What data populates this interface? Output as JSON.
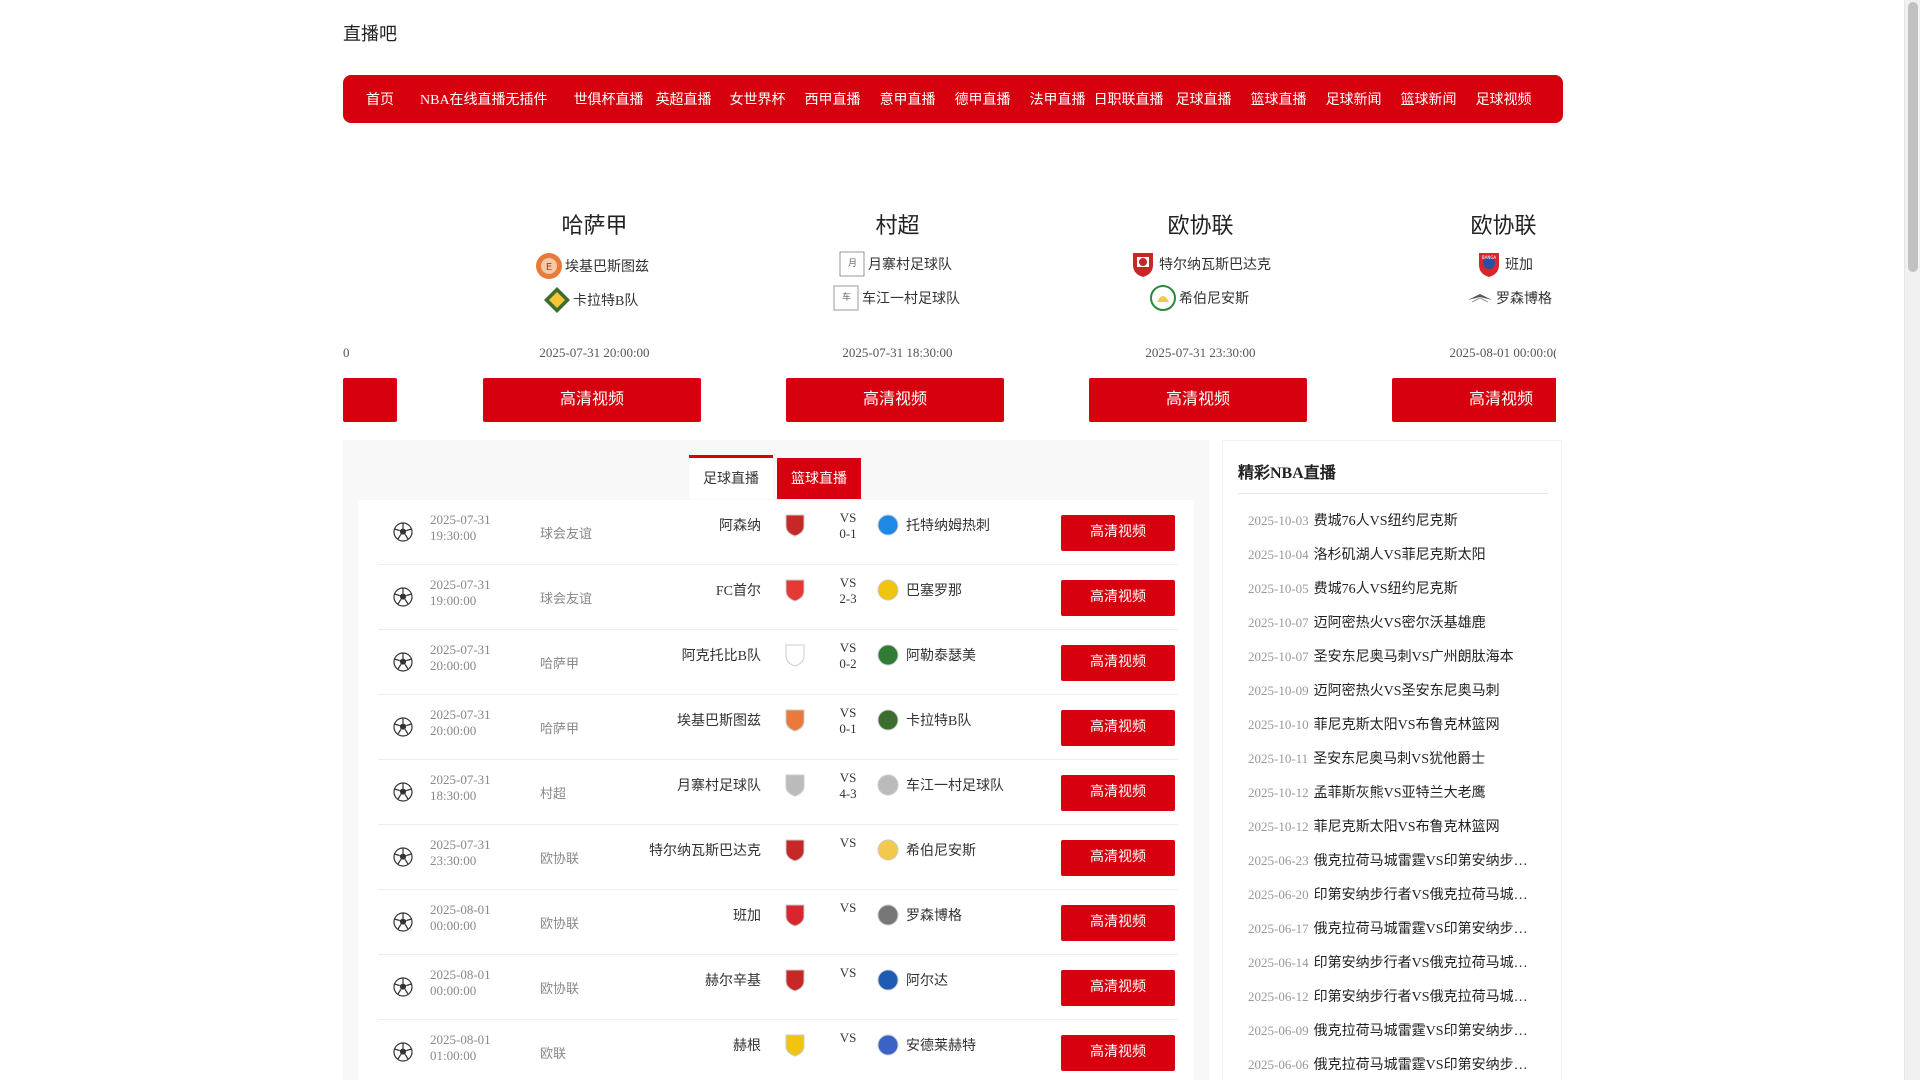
{
  "site": {
    "title": "直播吧"
  },
  "nav": [
    "首页",
    "NBA在线直播无插件",
    "世俱杯直播",
    "英超直播",
    "女世界杯",
    "西甲直播",
    "意甲直播",
    "德甲直播",
    "法甲直播",
    "日职联直播",
    "足球直播",
    "篮球直播",
    "足球新闻",
    "篮球新闻",
    "足球视频"
  ],
  "carousel": {
    "partial": {
      "time": "0",
      "button": ""
    },
    "slides": [
      {
        "league": "哈萨甲",
        "home": "埃基巴斯图兹",
        "away": "卡拉特B队",
        "time": "2025-07-31 20:00:00",
        "button": "高清视频"
      },
      {
        "league": "村超",
        "home": "月寨村足球队",
        "away": "车江一村足球队",
        "time": "2025-07-31 18:30:00",
        "button": "高清视频"
      },
      {
        "league": "欧协联",
        "home": "特尔纳瓦斯巴达克",
        "away": "希伯尼安斯",
        "time": "2025-07-31 23:30:00",
        "button": "高清视频"
      },
      {
        "league": "欧协联",
        "home": "班加",
        "away": "罗森博格",
        "time": "2025-08-01 00:00:0(",
        "button": "高清视频"
      }
    ]
  },
  "tabs": {
    "football": "足球直播",
    "basketball": "篮球直播"
  },
  "matches": [
    {
      "date": "2025-07-31",
      "time": "19:30:00",
      "league": "球会友谊",
      "home": "阿森纳",
      "vs": "VS",
      "score": "0-1",
      "away": "托特纳姆热刺",
      "button": "高清视频"
    },
    {
      "date": "2025-07-31",
      "time": "19:00:00",
      "league": "球会友谊",
      "home": "FC首尔",
      "vs": "VS",
      "score": "2-3",
      "away": "巴塞罗那",
      "button": "高清视频"
    },
    {
      "date": "2025-07-31",
      "time": "20:00:00",
      "league": "哈萨甲",
      "home": "阿克托比B队",
      "vs": "VS",
      "score": "0-2",
      "away": "阿勒泰瑟美",
      "button": "高清视频"
    },
    {
      "date": "2025-07-31",
      "time": "20:00:00",
      "league": "哈萨甲",
      "home": "埃基巴斯图兹",
      "vs": "VS",
      "score": "0-1",
      "away": "卡拉特B队",
      "button": "高清视频"
    },
    {
      "date": "2025-07-31",
      "time": "18:30:00",
      "league": "村超",
      "home": "月寨村足球队",
      "vs": "VS",
      "score": "4-3",
      "away": "车江一村足球队",
      "button": "高清视频"
    },
    {
      "date": "2025-07-31",
      "time": "23:30:00",
      "league": "欧协联",
      "home": "特尔纳瓦斯巴达克",
      "vs": "VS",
      "score": "",
      "away": "希伯尼安斯",
      "button": "高清视频"
    },
    {
      "date": "2025-08-01",
      "time": "00:00:00",
      "league": "欧协联",
      "home": "班加",
      "vs": "VS",
      "score": "",
      "away": "罗森博格",
      "button": "高清视频"
    },
    {
      "date": "2025-08-01",
      "time": "00:00:00",
      "league": "欧协联",
      "home": "赫尔辛基",
      "vs": "VS",
      "score": "",
      "away": "阿尔达",
      "button": "高清视频"
    },
    {
      "date": "2025-08-01",
      "time": "01:00:00",
      "league": "欧联",
      "home": "赫根",
      "vs": "VS",
      "score": "",
      "away": "安德莱赫特",
      "button": "高清视频"
    }
  ],
  "sidebar": {
    "title": "精彩NBA直播",
    "items": [
      {
        "date": "2025-10-03",
        "title": "费城76人VS纽约尼克斯"
      },
      {
        "date": "2025-10-04",
        "title": "洛杉矶湖人VS菲尼克斯太阳"
      },
      {
        "date": "2025-10-05",
        "title": "费城76人VS纽约尼克斯"
      },
      {
        "date": "2025-10-07",
        "title": "迈阿密热火VS密尔沃基雄鹿"
      },
      {
        "date": "2025-10-07",
        "title": "圣安东尼奥马刺VS广州朗肽海本"
      },
      {
        "date": "2025-10-09",
        "title": "迈阿密热火VS圣安东尼奥马刺"
      },
      {
        "date": "2025-10-10",
        "title": "菲尼克斯太阳VS布鲁克林篮网"
      },
      {
        "date": "2025-10-11",
        "title": "圣安东尼奥马刺VS犹他爵士"
      },
      {
        "date": "2025-10-12",
        "title": "孟菲斯灰熊VS亚特兰大老鹰"
      },
      {
        "date": "2025-10-12",
        "title": "菲尼克斯太阳VS布鲁克林篮网"
      },
      {
        "date": "2025-06-23",
        "title": "俄克拉荷马城雷霆VS印第安纳步…"
      },
      {
        "date": "2025-06-20",
        "title": "印第安纳步行者VS俄克拉荷马城…"
      },
      {
        "date": "2025-06-17",
        "title": "俄克拉荷马城雷霆VS印第安纳步…"
      },
      {
        "date": "2025-06-14",
        "title": "印第安纳步行者VS俄克拉荷马城…"
      },
      {
        "date": "2025-06-12",
        "title": "印第安纳步行者VS俄克拉荷马城…"
      },
      {
        "date": "2025-06-09",
        "title": "俄克拉荷马城雷霆VS印第安纳步…"
      },
      {
        "date": "2025-06-06",
        "title": "俄克拉荷马城雷霆VS印第安纳步…"
      }
    ]
  }
}
